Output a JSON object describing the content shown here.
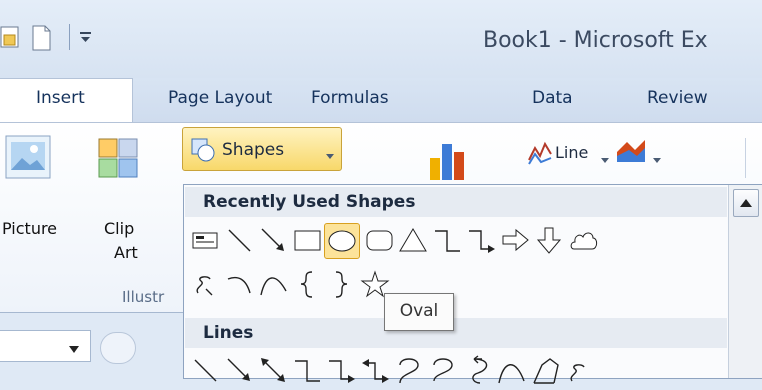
{
  "window": {
    "title": "Book1  -  Microsoft Ex"
  },
  "tabs": [
    {
      "label": "Insert",
      "active": true
    },
    {
      "label": "Page Layout"
    },
    {
      "label": "Formulas"
    },
    {
      "label": "Data"
    },
    {
      "label": "Review"
    }
  ],
  "ribbon": {
    "picture_label": "Picture",
    "clip_art_label_1": "Clip",
    "clip_art_label_2": "Art",
    "group_label": "Illustr",
    "shapes_button": "Shapes",
    "line_button": "Line"
  },
  "dropdown": {
    "recent_header": "Recently Used Shapes",
    "lines_header": "Lines",
    "recent_shapes": [
      "text-box",
      "line",
      "arrow-line",
      "rectangle",
      "oval",
      "rounded-rectangle",
      "triangle",
      "elbow-connector",
      "elbow-arrow-connector",
      "right-arrow",
      "down-arrow",
      "cloud-shape",
      "freeform",
      "arc",
      "curve",
      "left-brace",
      "right-brace",
      "star"
    ],
    "line_shapes": [
      "line",
      "arrow-line",
      "double-arrow-line",
      "elbow-connector",
      "elbow-arrow-connector",
      "elbow-double-arrow-connector",
      "curved-connector",
      "curved-arrow-connector",
      "curved-double-arrow-connector",
      "curve",
      "freeform",
      "scribble"
    ],
    "selected_shape": "oval"
  },
  "tooltip": {
    "text": "Oval"
  },
  "colors": {
    "accent": "#f8d86a",
    "ribbon_bg": "#dfe9f5",
    "text_dark": "#15325c"
  }
}
